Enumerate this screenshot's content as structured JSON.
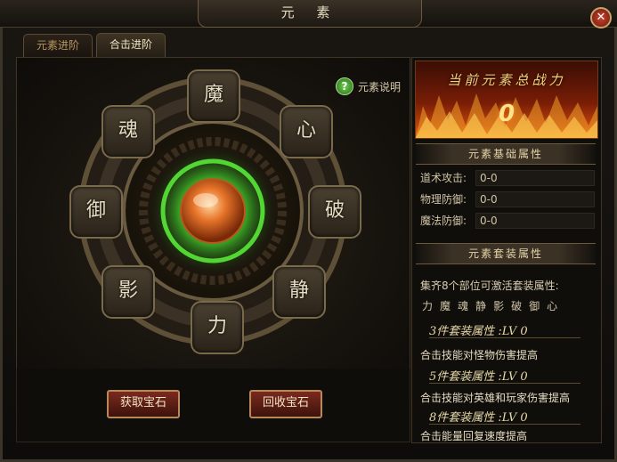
{
  "window": {
    "title": "元 素",
    "close_glyph": "✕"
  },
  "tabs": [
    {
      "label": "元素进阶",
      "active": false
    },
    {
      "label": "合击进阶",
      "active": true
    }
  ],
  "help": {
    "icon_glyph": "?",
    "label": "元素说明"
  },
  "wheel": {
    "segments": [
      "魔",
      "心",
      "破",
      "静",
      "力",
      "影",
      "御",
      "魂"
    ]
  },
  "buttons": {
    "get_gem": "获取宝石",
    "recycle_gem": "回收宝石"
  },
  "power": {
    "title": "当前元素总战力",
    "value": "0"
  },
  "basic": {
    "title": "元素基础属性",
    "rows": [
      {
        "label": "道术攻击:",
        "value": "0-0"
      },
      {
        "label": "物理防御:",
        "value": "0-0"
      },
      {
        "label": "魔法防御:",
        "value": "0-0"
      }
    ]
  },
  "set": {
    "title": "元素套装属性",
    "intro": "集齐8个部位可激活套装属性:",
    "elements": [
      "力",
      "魔",
      "魂",
      "静",
      "影",
      "破",
      "御",
      "心"
    ],
    "tiers": [
      {
        "level": "3件套装属性 :LV 0",
        "desc": "合击技能对怪物伤害提高"
      },
      {
        "level": "5件套装属性 :LV 0",
        "desc": "合击技能对英雄和玩家伤害提高"
      },
      {
        "level": "8件套装属性 :LV 0",
        "desc": "合击能量回复速度提高"
      }
    ]
  },
  "colors": {
    "accent_gold": "#c8a46a",
    "gem_green": "#3fd12a",
    "gem_orange": "#e8752a",
    "button_red": "#7a2a1d"
  }
}
